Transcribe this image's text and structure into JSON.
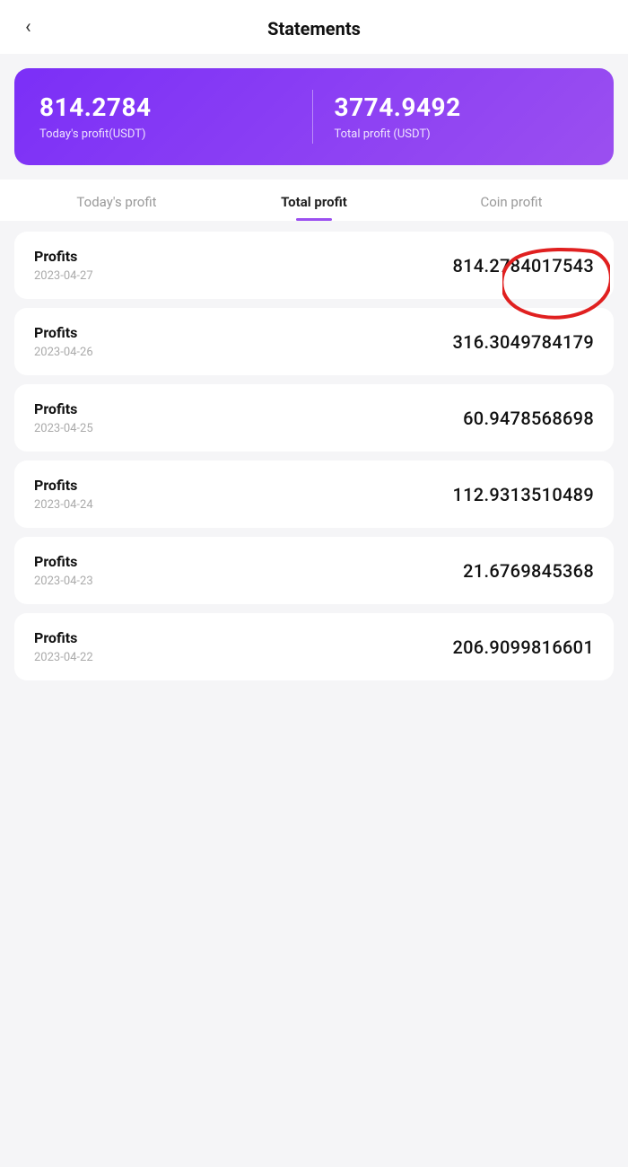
{
  "header": {
    "title": "Statements",
    "back_icon": "‹"
  },
  "summary": {
    "today_value": "814.2784",
    "today_label": "Today's profit(USDT)",
    "total_value": "3774.9492",
    "total_label": "Total profit (USDT)"
  },
  "tabs": [
    {
      "id": "today",
      "label": "Today's profit",
      "active": false
    },
    {
      "id": "total",
      "label": "Total profit",
      "active": true
    },
    {
      "id": "coin",
      "label": "Coin profit",
      "active": false
    }
  ],
  "profits": [
    {
      "title": "Profits",
      "date": "2023-04-27",
      "amount": "814.2784017543",
      "annotated": true
    },
    {
      "title": "Profits",
      "date": "2023-04-26",
      "amount": "316.3049784179"
    },
    {
      "title": "Profits",
      "date": "2023-04-25",
      "amount": "60.9478568698"
    },
    {
      "title": "Profits",
      "date": "2023-04-24",
      "amount": "112.9313510489"
    },
    {
      "title": "Profits",
      "date": "2023-04-23",
      "amount": "21.6769845368"
    },
    {
      "title": "Profits",
      "date": "2023-04-22",
      "amount": "206.9099816601"
    }
  ]
}
